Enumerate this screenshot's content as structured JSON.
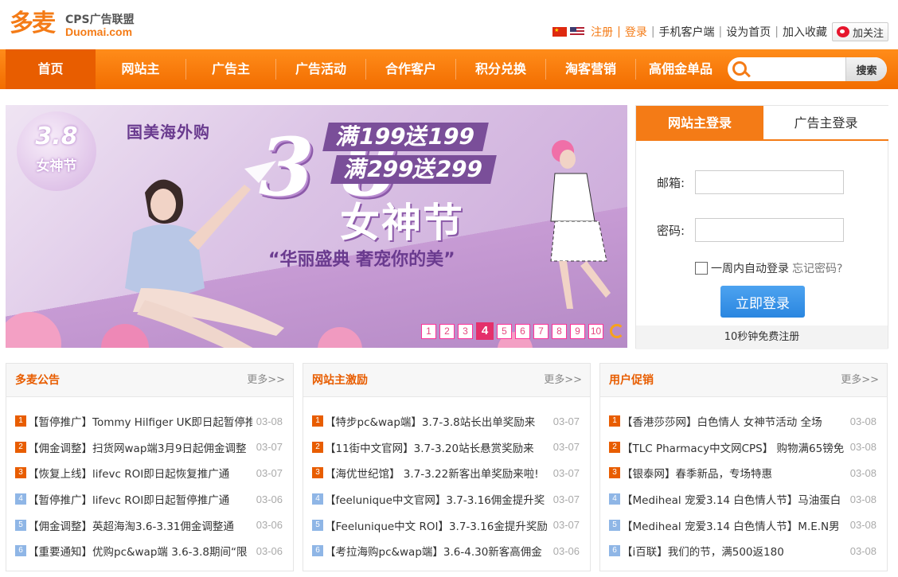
{
  "logo": {
    "mark": "多麦",
    "tagline": "CPS广告联盟",
    "url": "Duomai.com"
  },
  "toplinks": {
    "register": "注册",
    "divider": "|",
    "login": "登录",
    "mobile": "手机客户端",
    "homepage": "设为首页",
    "favorite": "加入收藏",
    "follow": "加关注"
  },
  "nav": {
    "items": [
      {
        "label": "首页"
      },
      {
        "label": "网站主"
      },
      {
        "label": "广告主"
      },
      {
        "label": "广告活动"
      },
      {
        "label": "合作客户"
      },
      {
        "label": "积分兑换"
      },
      {
        "label": "淘客营销"
      },
      {
        "label": "高佣金单品"
      }
    ],
    "search_placeholder": "",
    "search_button": "搜索"
  },
  "banner": {
    "badge_top": "3.8",
    "badge_bottom": "女神节",
    "brand": "国美海外购",
    "big_number": "3 8",
    "offer1": "满199送199",
    "offer2": "满299送299",
    "festival": "女神节",
    "slogan": "“华丽盛典 奢宠你的美”",
    "pages": [
      "1",
      "2",
      "3",
      "4",
      "5",
      "6",
      "7",
      "8",
      "9",
      "10"
    ],
    "active_page": "4"
  },
  "login": {
    "tab_active": "网站主登录",
    "tab_inactive": "广告主登录",
    "email_label": "邮箱:",
    "password_label": "密码:",
    "remember": "一周内自动登录",
    "forgot": "忘记密码?",
    "submit": "立即登录",
    "register_hint": "10秒钟免费注册"
  },
  "boxes": [
    {
      "title": "多麦公告",
      "more": "更多>>",
      "items": [
        {
          "num": "1",
          "text": "【暂停推广】Tommy Hilfiger UK即日起暂停推",
          "date": "03-08"
        },
        {
          "num": "2",
          "text": "【佣金调整】扫货网wap端3月9日起佣金调整",
          "date": "03-07"
        },
        {
          "num": "3",
          "text": "【恢复上线】lifevc ROI即日起恢复推广通",
          "date": "03-07"
        },
        {
          "num": "4",
          "text": "【暂停推广】lifevc ROI即日起暂停推广通",
          "date": "03-06"
        },
        {
          "num": "5",
          "text": "【佣金调整】英超海淘3.6-3.31佣金调整通",
          "date": "03-06"
        },
        {
          "num": "6",
          "text": "【重要通知】优购pc&wap端 3.6-3.8期间“限",
          "date": "03-06"
        }
      ]
    },
    {
      "title": "网站主激励",
      "more": "更多>>",
      "items": [
        {
          "num": "1",
          "text": "【特步pc&wap端】3.7-3.8站长出单奖励来",
          "date": "03-07"
        },
        {
          "num": "2",
          "text": "【11街中文官网】3.7-3.20站长悬赏奖励来",
          "date": "03-07"
        },
        {
          "num": "3",
          "text": "【海优世纪馆】 3.7-3.22新客出单奖励来啦!",
          "date": "03-07"
        },
        {
          "num": "4",
          "text": "【feelunique中文官网】3.7-3.16佣金提升奖",
          "date": "03-07"
        },
        {
          "num": "5",
          "text": "【Feelunique中文 ROI】3.7-3.16金提升奖励",
          "date": "03-07"
        },
        {
          "num": "6",
          "text": "【考拉海购pc&wap端】3.6-4.30新客高佣金",
          "date": "03-06"
        }
      ]
    },
    {
      "title": "用户促销",
      "more": "更多>>",
      "items": [
        {
          "num": "1",
          "text": "【香港莎莎网】白色情人 女神节活动 全场",
          "date": "03-08"
        },
        {
          "num": "2",
          "text": "【TLC Pharmacy中文网CPS】 购物满65镑免",
          "date": "03-08"
        },
        {
          "num": "3",
          "text": "【银泰网】春季新品，专场特惠",
          "date": "03-08"
        },
        {
          "num": "4",
          "text": "【Mediheal 宠爱3.14 白色情人节】马油蛋白",
          "date": "03-08"
        },
        {
          "num": "5",
          "text": "【Mediheal 宠爱3.14 白色情人节】M.E.N男",
          "date": "03-08"
        },
        {
          "num": "6",
          "text": "【i百联】我们的节，满500返180",
          "date": "03-08"
        }
      ]
    }
  ],
  "colors": {
    "brand": "#f47b16",
    "nav_active": "#e85d00",
    "login_button": "#2a86e0",
    "pager": "#e4306b"
  }
}
